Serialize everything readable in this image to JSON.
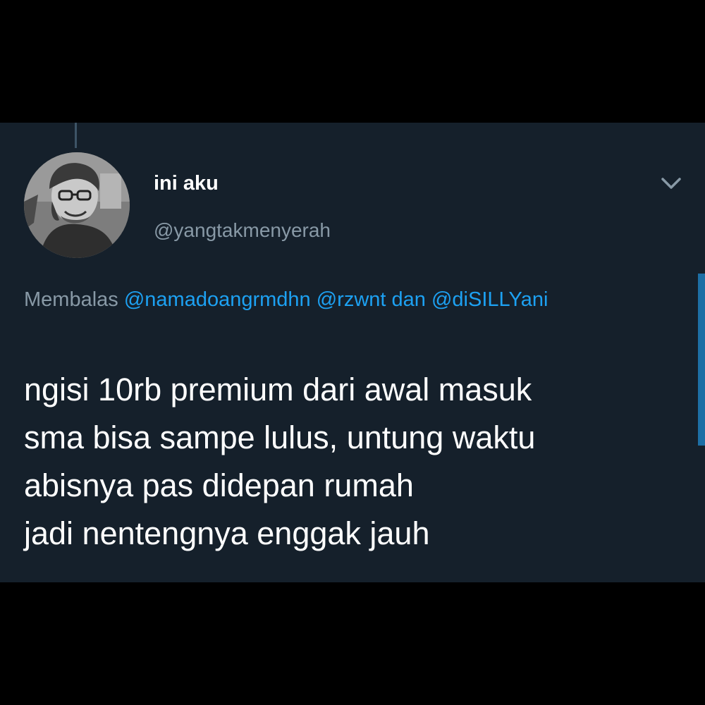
{
  "tweet": {
    "display_name": "ini aku",
    "handle": "@yangtakmenyerah",
    "avatar_icon": "user-photo-avatar",
    "menu_icon": "chevron-down-icon",
    "reply": {
      "prefix": "Membalas",
      "mentions": [
        "@namadoangrmdhn",
        "@rzwnt"
      ],
      "conjunction": "dan",
      "last_mention": "@diSILLYani"
    },
    "text_lines": [
      "ngisi 10rb premium dari awal masuk",
      "sma bisa sampe lulus, untung waktu",
      "abisnya pas didepan rumah",
      "jadi nentengnya enggak jauh"
    ]
  },
  "colors": {
    "background": "#000000",
    "card": "#15202b",
    "primary_text": "#ffffff",
    "secondary_text": "#8899a6",
    "accent": "#1da1f2"
  }
}
